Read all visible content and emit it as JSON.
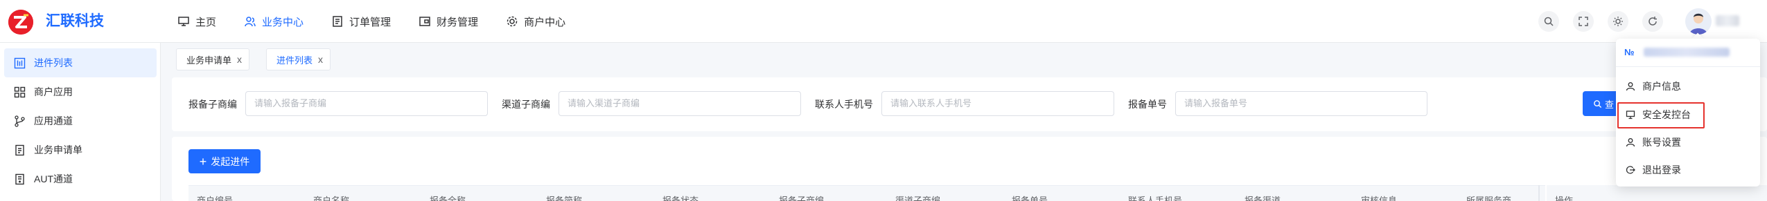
{
  "brand": {
    "name": "汇联科技"
  },
  "nav": [
    {
      "label": "主页",
      "icon": "monitor-icon"
    },
    {
      "label": "业务中心",
      "icon": "users-icon"
    },
    {
      "label": "订单管理",
      "icon": "order-icon"
    },
    {
      "label": "财务管理",
      "icon": "finance-icon"
    },
    {
      "label": "商户中心",
      "icon": "gear-icon"
    }
  ],
  "toolbar_icons": [
    "search-icon",
    "fullscreen-icon",
    "theme-icon",
    "refresh-icon"
  ],
  "sidebar": [
    {
      "label": "进件列表",
      "icon": "list-icon"
    },
    {
      "label": "商户应用",
      "icon": "apps-icon"
    },
    {
      "label": "应用通道",
      "icon": "branch-icon"
    },
    {
      "label": "业务申请单",
      "icon": "document-icon"
    },
    {
      "label": "AUT通道",
      "icon": "channel-icon"
    }
  ],
  "tabs": [
    {
      "label": "业务申请单",
      "close": "x"
    },
    {
      "label": "进件列表",
      "close": "x"
    }
  ],
  "filters": [
    {
      "label": "报备子商编",
      "placeholder": "请输入报备子商编"
    },
    {
      "label": "渠道子商编",
      "placeholder": "请输入渠道子商编"
    },
    {
      "label": "联系人手机号",
      "placeholder": "请输入联系人手机号"
    },
    {
      "label": "报备单号",
      "placeholder": "请输入报备单号"
    }
  ],
  "search_button": {
    "label": "查"
  },
  "add_button": {
    "label": "发起进件"
  },
  "table_headers": [
    "商户编号",
    "商户名称",
    "报备全称",
    "报备简称",
    "报备状态",
    "报备子商编",
    "渠道子商编",
    "报备单号",
    "联系人手机号",
    "报备渠道",
    "审核信息",
    "所属服务商",
    "操作"
  ],
  "dropdown": {
    "no_label": "№",
    "items": [
      {
        "label": "商户信息",
        "icon": "user-icon"
      },
      {
        "label": "安全发控台",
        "icon": "monitor-icon"
      },
      {
        "label": "账号设置",
        "icon": "user-settings-icon"
      },
      {
        "label": "退出登录",
        "icon": "logout-icon"
      }
    ]
  },
  "colors": {
    "accent": "#1f6bff",
    "logo": "#e8202a",
    "highlight": "#e5322d"
  }
}
